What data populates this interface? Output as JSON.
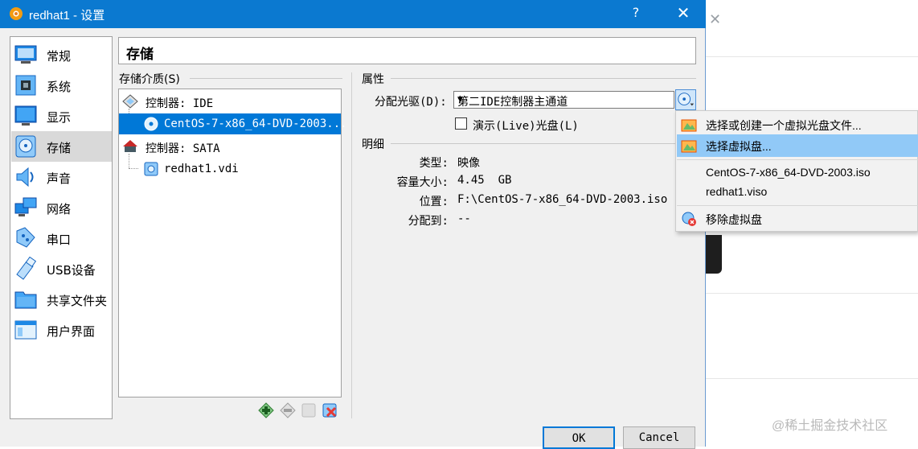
{
  "window": {
    "title": "redhat1 - 设置",
    "help_label": "?",
    "close_label": "✕",
    "bg_close_label": "✕"
  },
  "sidebar": {
    "items": [
      {
        "label": "常规",
        "icon": "general-icon"
      },
      {
        "label": "系统",
        "icon": "system-icon"
      },
      {
        "label": "显示",
        "icon": "display-icon"
      },
      {
        "label": "存储",
        "icon": "storage-icon",
        "active": true
      },
      {
        "label": "声音",
        "icon": "audio-icon"
      },
      {
        "label": "网络",
        "icon": "network-icon"
      },
      {
        "label": "串口",
        "icon": "serial-port-icon"
      },
      {
        "label": "USB设备",
        "icon": "usb-icon"
      },
      {
        "label": "共享文件夹",
        "icon": "shared-folder-icon"
      },
      {
        "label": "用户界面",
        "icon": "user-interface-icon"
      }
    ]
  },
  "page": {
    "title": "存储"
  },
  "storage": {
    "group_label": "存储介质(S)",
    "tree": [
      {
        "label": "控制器: IDE",
        "kind": "controller"
      },
      {
        "label": "CentOS-7-x86_64-DVD-2003...",
        "kind": "optical",
        "selected": true
      },
      {
        "label": "控制器: SATA",
        "kind": "controller"
      },
      {
        "label": "redhat1.vdi",
        "kind": "hdd"
      }
    ]
  },
  "attributes": {
    "group_label": "属性",
    "drive_label": "分配光驱(D):",
    "drive_value": "第二IDE控制器主通道",
    "live_label": "演示(Live)光盘(L)",
    "live_checked": false
  },
  "details": {
    "group_label": "明细",
    "rows": [
      {
        "key": "类型:",
        "value": "映像"
      },
      {
        "key": "容量大小:",
        "value": "4.45  GB"
      },
      {
        "key": "位置:",
        "value": "F:\\CentOS-7-x86_64-DVD-2003.iso"
      },
      {
        "key": "分配到:",
        "value": "--"
      }
    ]
  },
  "buttons": {
    "ok": "OK",
    "cancel": "Cancel"
  },
  "menu": {
    "items": [
      {
        "label": "选择或创建一个虚拟光盘文件...",
        "icon": "folder-add-icon"
      },
      {
        "label": "选择虚拟盘...",
        "icon": "folder-open-icon",
        "highlighted": true
      },
      {
        "label": "CentOS-7-x86_64-DVD-2003.iso"
      },
      {
        "label": "redhat1.viso"
      },
      {
        "label": "移除虚拟盘",
        "icon": "remove-disc-icon"
      }
    ]
  },
  "watermark": "@稀土掘金技术社区",
  "colors": {
    "titlebar": "#0b79d0",
    "selection": "#0078d7",
    "menu_highlight": "#91c9f7"
  }
}
